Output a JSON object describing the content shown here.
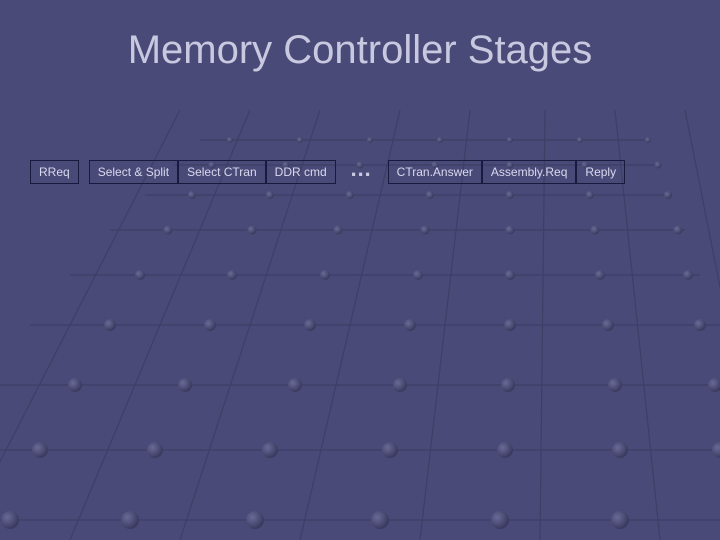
{
  "title": "Memory Controller Stages",
  "ellipsis": "…",
  "stages": {
    "left": [
      {
        "label": "RReq"
      },
      {
        "label": "Select & Split"
      },
      {
        "label": "Select CTran"
      },
      {
        "label": "DDR cmd"
      }
    ],
    "right": [
      {
        "label": "CTran.Answer"
      },
      {
        "label": "Assembly.Req"
      },
      {
        "label": "Reply"
      }
    ]
  }
}
